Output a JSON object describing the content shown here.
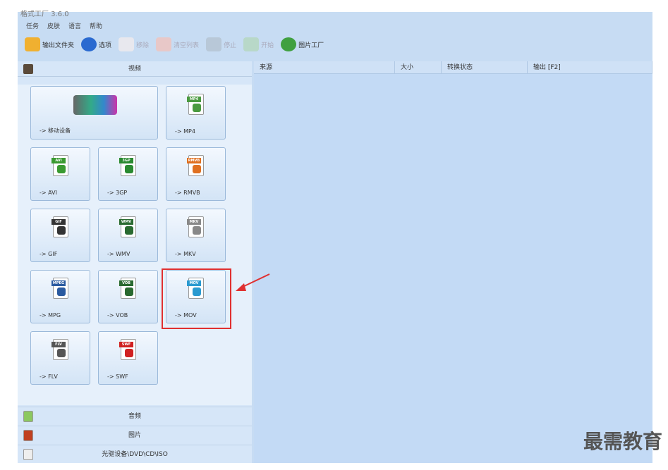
{
  "window": {
    "title": "格式工厂 3.6.0"
  },
  "menu": [
    "任务",
    "皮肤",
    "语言",
    "帮助"
  ],
  "toolbar": [
    {
      "label": "输出文件夹",
      "icon": "folder-icon",
      "enabled": true,
      "color": "#f0b030"
    },
    {
      "label": "选项",
      "icon": "gear-icon",
      "enabled": true,
      "color": "#2a6ad0"
    },
    {
      "label": "移除",
      "icon": "remove-icon",
      "enabled": false,
      "color": "#e8e8ee"
    },
    {
      "label": "清空列表",
      "icon": "clear-icon",
      "enabled": false,
      "color": "#e8c8c8"
    },
    {
      "label": "停止",
      "icon": "stop-icon",
      "enabled": false,
      "color": "#b8c8d8"
    },
    {
      "label": "开始",
      "icon": "start-icon",
      "enabled": false,
      "color": "#b8d8c8"
    },
    {
      "label": "图片工厂",
      "icon": "picture-factory-icon",
      "enabled": true,
      "color": "#40a040"
    }
  ],
  "left": {
    "header": "视频",
    "tiles": [
      {
        "label": "-> 移动设备",
        "badge": "",
        "color": "#444"
      },
      {
        "label": "-> MP4",
        "badge": "MP4",
        "color": "#4a9a40"
      },
      {
        "label": "-> AVI",
        "badge": "AVI",
        "color": "#3a9a30"
      },
      {
        "label": "-> 3GP",
        "badge": "3GP",
        "color": "#2a8a30"
      },
      {
        "label": "-> RMVB",
        "badge": "RMVB",
        "color": "#e07020"
      },
      {
        "label": "-> GIF",
        "badge": "GIF",
        "color": "#333"
      },
      {
        "label": "-> WMV",
        "badge": "WMV",
        "color": "#2a6a30"
      },
      {
        "label": "-> MKV",
        "badge": "MKV",
        "color": "#888"
      },
      {
        "label": "-> MPG",
        "badge": "MPEG",
        "color": "#2a5aa0"
      },
      {
        "label": "-> VOB",
        "badge": "VOB",
        "color": "#2a6a30"
      },
      {
        "label": "-> MOV",
        "badge": "MOV",
        "color": "#2a9ad0"
      },
      {
        "label": "-> FLV",
        "badge": "FLV",
        "color": "#555"
      },
      {
        "label": "-> SWF",
        "badge": "SWF",
        "color": "#d02020"
      }
    ],
    "categories": [
      {
        "label": "音频",
        "icon": "music-icon",
        "color": "#8cc860"
      },
      {
        "label": "图片",
        "icon": "picture-icon",
        "color": "#c04020"
      },
      {
        "label": "光驱设备\\DVD\\CD\\ISO",
        "icon": "disc-drive-icon",
        "color": "#eeeeee"
      }
    ]
  },
  "table": {
    "columns": [
      "来源",
      "大小",
      "转换状态",
      "输出 [F2]"
    ]
  },
  "annotation": {
    "highlight": "-> MOV",
    "color": "#e03030"
  },
  "watermark": "最需教育"
}
